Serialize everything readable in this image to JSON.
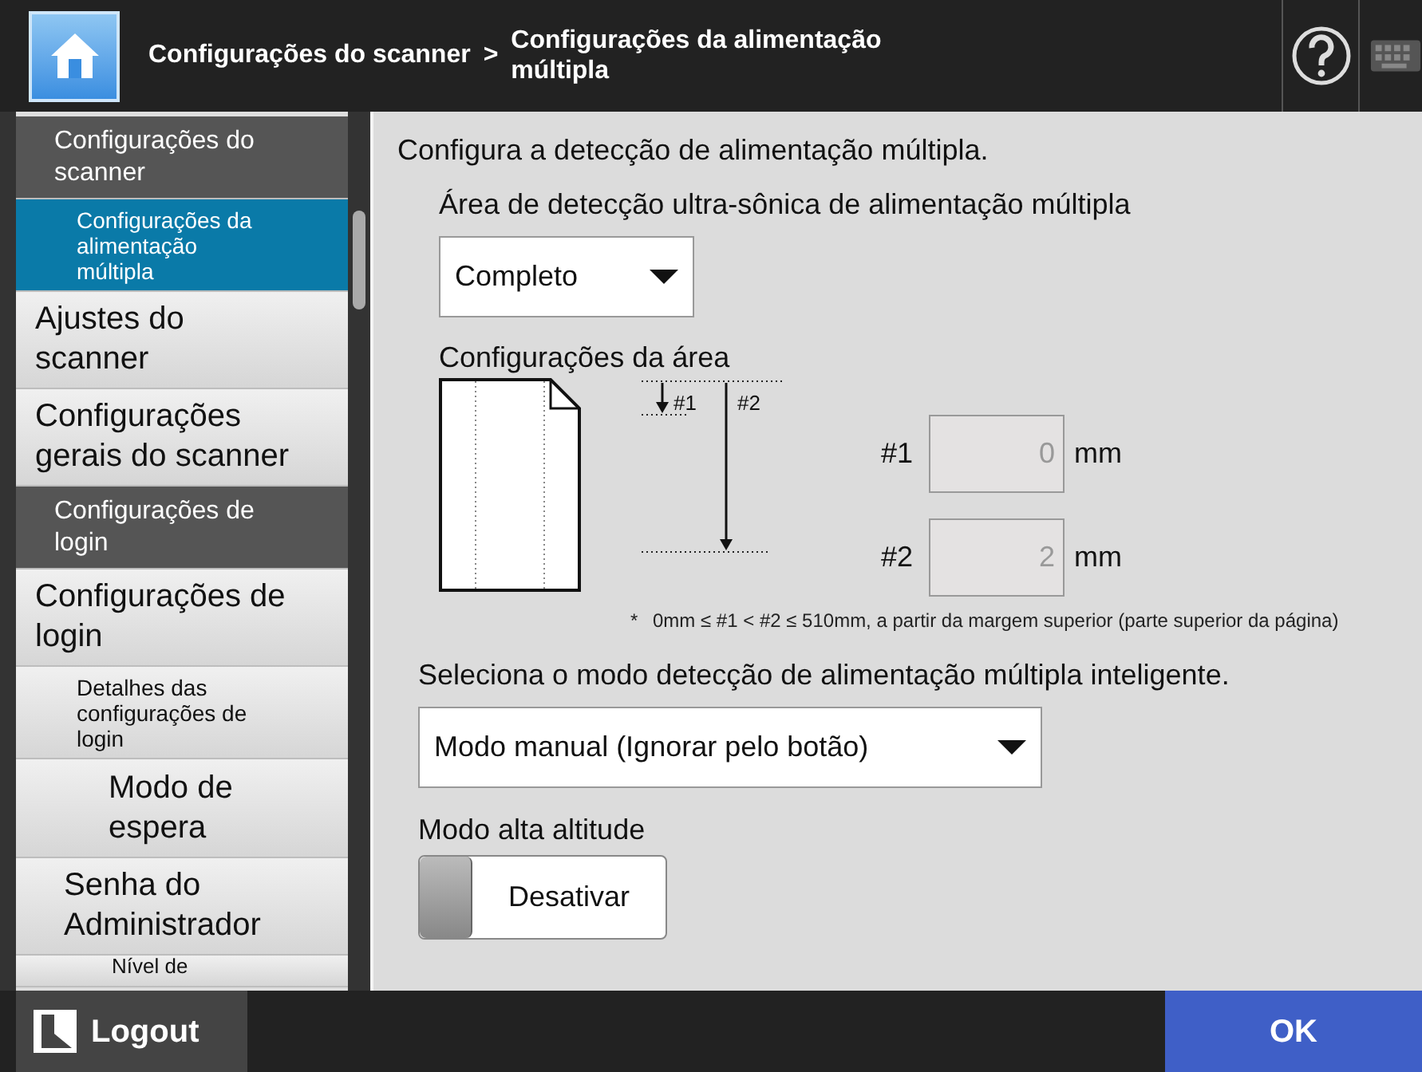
{
  "header": {
    "breadcrumb": [
      "Configurações do scanner",
      "Configurações da alimentação múltipla"
    ],
    "separator": ">"
  },
  "sidebar": {
    "items": [
      {
        "kind": "group",
        "label": "Configurações do scanner"
      },
      {
        "kind": "subitem",
        "label": "Configurações da alimentação múltipla",
        "selected": true
      },
      {
        "kind": "item",
        "label": "Ajustes do scanner",
        "selected": false
      },
      {
        "kind": "item",
        "label": "Configurações gerais do scanner",
        "selected": false
      },
      {
        "kind": "group",
        "label": "Configurações de login"
      },
      {
        "kind": "item",
        "label": "Configurações de login",
        "selected": false
      },
      {
        "kind": "subitem",
        "label": "Detalhes das configurações de login",
        "selected": false
      },
      {
        "kind": "centered",
        "label": "Modo de espera",
        "selected": false
      },
      {
        "kind": "item",
        "label": "Senha do Administrador",
        "selected": false
      },
      {
        "kind": "cut",
        "label": "Nível de",
        "selected": false
      }
    ]
  },
  "content": {
    "description": "Configura a detecção de alimentação múltipla.",
    "area_label": "Área de detecção ultra-sônica de alimentação múltipla",
    "area_dropdown": "Completo",
    "area_settings_label": "Configurações da área",
    "diagram_labels": [
      "#1",
      "#2"
    ],
    "fields": [
      {
        "label": "#1",
        "value": "0",
        "unit": "mm",
        "disabled": true
      },
      {
        "label": "#2",
        "value": "2",
        "unit": "mm",
        "disabled": true
      }
    ],
    "note_mark": "*",
    "note": "0mm ≤ #1 < #2 ≤ 510mm, a partir da margem superior (parte superior da página)",
    "mode_label": "Seleciona o modo detecção de alimentação múltipla inteligente.",
    "mode_dropdown": "Modo manual (Ignorar pelo botão)",
    "altitude_label": "Modo alta altitude",
    "altitude_toggle": {
      "label": "Desativar",
      "on": false
    }
  },
  "footer": {
    "logout": "Logout",
    "ok": "OK"
  }
}
